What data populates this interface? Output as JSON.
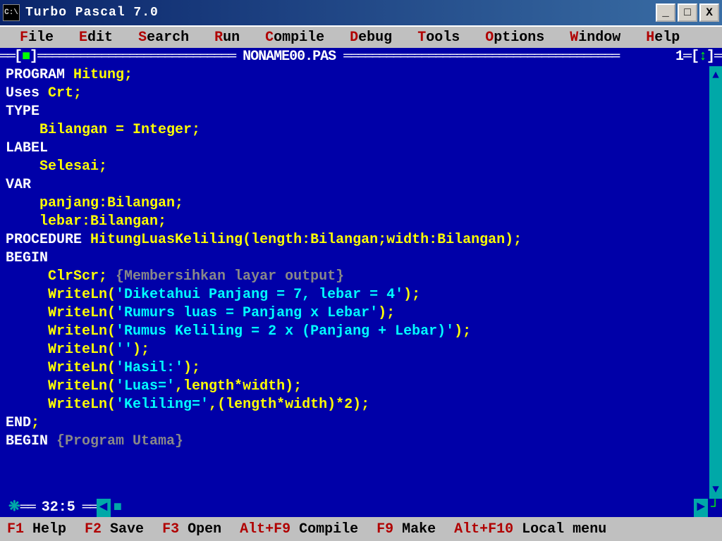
{
  "titlebar": {
    "icon_text": "C:\\",
    "title": "Turbo Pascal 7.0"
  },
  "win_controls": {
    "minimize": "_",
    "maximize": "□",
    "close": "X"
  },
  "menu": {
    "file": {
      "hotkey": "F",
      "rest": "ile"
    },
    "edit": {
      "hotkey": "E",
      "rest": "dit"
    },
    "search": {
      "hotkey": "S",
      "rest": "earch"
    },
    "run": {
      "hotkey": "R",
      "rest": "un"
    },
    "compile": {
      "hotkey": "C",
      "rest": "ompile"
    },
    "debug": {
      "hotkey": "D",
      "rest": "ebug"
    },
    "tools": {
      "hotkey": "T",
      "rest": "ools"
    },
    "options": {
      "hotkey": "O",
      "rest": "ptions"
    },
    "window": {
      "hotkey": "W",
      "rest": "indow"
    },
    "help": {
      "hotkey": "H",
      "rest": "elp"
    }
  },
  "editor": {
    "filename": "NONAME00.PAS",
    "window_number": "1",
    "cursor_pos": "32:5"
  },
  "code": {
    "l1": {
      "kw": "PROGRAM ",
      "rest": "Hitung;"
    },
    "l2": {
      "kw": "Uses ",
      "rest": "Crt;"
    },
    "l3": {
      "kw": "TYPE",
      "rest": ""
    },
    "l4": {
      "kw": "",
      "rest": "    Bilangan = Integer;"
    },
    "l5": {
      "kw": "LABEL",
      "rest": ""
    },
    "l6": {
      "kw": "",
      "rest": "    Selesai;"
    },
    "l7": {
      "kw": "VAR",
      "rest": ""
    },
    "l8": {
      "kw": "",
      "rest": "    panjang:Bilangan;"
    },
    "l9": {
      "kw": "",
      "rest": "    lebar:Bilangan;"
    },
    "l10": {
      "kw": "PROCEDURE ",
      "rest": "HitungLuasKeliling(length:Bilangan;width:Bilangan);"
    },
    "l11": {
      "kw": "BEGIN",
      "rest": ""
    },
    "l12": {
      "pre": "     ClrScr; ",
      "comment": "{Membersihkan layar output}"
    },
    "l13": {
      "pre": "     WriteLn(",
      "str": "'Diketahui Panjang = 7, lebar = 4'",
      "post": ");"
    },
    "l14": {
      "pre": "     WriteLn(",
      "str": "'Rumurs luas = Panjang x Lebar'",
      "post": ");"
    },
    "l15": {
      "pre": "     WriteLn(",
      "str": "'Rumus Keliling = 2 x (Panjang + Lebar)'",
      "post": ");"
    },
    "l16": {
      "pre": "     WriteLn(",
      "str": "''",
      "post": ");"
    },
    "l17": {
      "pre": "     WriteLn(",
      "str": "'Hasil:'",
      "post": ");"
    },
    "l18": {
      "pre": "     WriteLn(",
      "str": "'Luas='",
      "post": ",length*width);"
    },
    "l19": {
      "pre": "     WriteLn(",
      "str": "'Keliling='",
      "post": ",(length*width)*2);"
    },
    "l20": {
      "kw": "END",
      "rest": ";"
    },
    "l21": {
      "kw": "BEGIN ",
      "comment": "{Program Utama}"
    }
  },
  "statusbar": {
    "s1": {
      "fkey": "F1 ",
      "label": "Help"
    },
    "s2": {
      "fkey": "F2 ",
      "label": "Save"
    },
    "s3": {
      "fkey": "F3 ",
      "label": "Open"
    },
    "s4": {
      "fkey": "Alt+F9 ",
      "label": "Compile"
    },
    "s5": {
      "fkey": "F9 ",
      "label": "Make"
    },
    "s6": {
      "fkey": "Alt+F10 ",
      "label": "Local menu"
    }
  }
}
